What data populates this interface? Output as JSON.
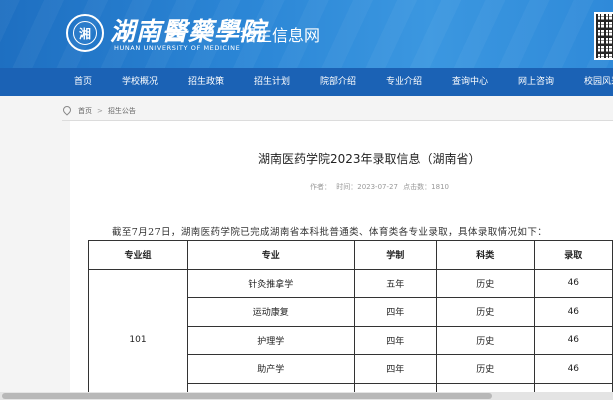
{
  "header": {
    "school_name": "湖南醫藥學院",
    "school_name_en": "HUNAN UNIVERSITY OF MEDICINE",
    "site_title": "招生信息网",
    "emblem_glyph": "湘",
    "brand_color": "#1e6fc1"
  },
  "nav": {
    "items": [
      "首页",
      "学校概况",
      "招生政策",
      "招生计划",
      "院部介绍",
      "专业介绍",
      "查询中心",
      "网上咨询",
      "校园风采"
    ],
    "background_color": "#1b62b5"
  },
  "breadcrumb": {
    "icon": "location-icon",
    "home": "首页",
    "separator": ">",
    "current": "招生公告"
  },
  "article": {
    "title": "湖南医药学院2023年录取信息（湖南省）",
    "author_label": "作者：",
    "time_label": "时间：2023-07-27",
    "hits_label": "点击数：1810",
    "intro": "截至7月27日，湖南医药学院已完成湖南省本科批普通类、体育类各专业录取，具体录取情况如下："
  },
  "table": {
    "headers": [
      "专业组",
      "专业",
      "学制",
      "科类",
      "录取"
    ],
    "group": "101",
    "rows": [
      {
        "major": "针灸推拿学",
        "duration": "五年",
        "category": "历史",
        "score": "46"
      },
      {
        "major": "运动康复",
        "duration": "四年",
        "category": "历史",
        "score": "46"
      },
      {
        "major": "护理学",
        "duration": "四年",
        "category": "历史",
        "score": "46"
      },
      {
        "major": "助产学",
        "duration": "四年",
        "category": "历史",
        "score": "46"
      },
      {
        "major": "",
        "duration": "",
        "category": "",
        "score": ""
      }
    ]
  }
}
